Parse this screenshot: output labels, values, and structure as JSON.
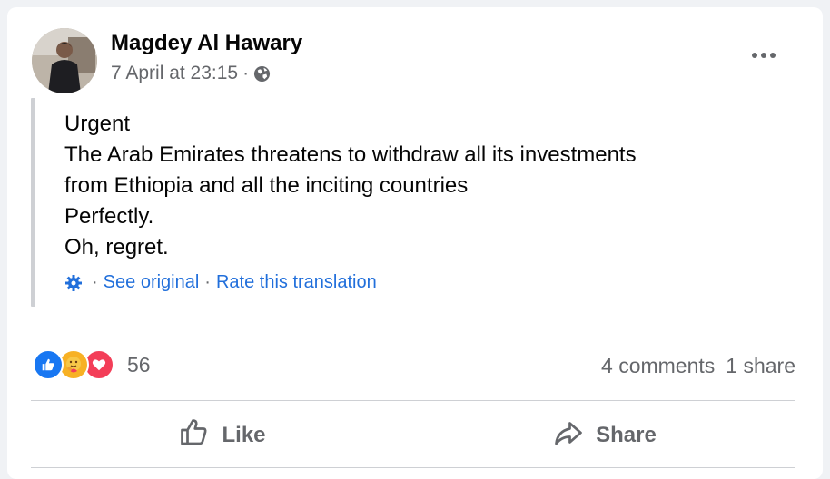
{
  "post": {
    "author": "Magdey Al Hawary",
    "timestamp": "7 April at 23:15",
    "separator": "·",
    "privacy_icon": "globe-icon",
    "lines": [
      "Urgent",
      "The Arab Emirates threatens to withdraw all its investments",
      "from Ethiopia and all the inciting countries",
      "Perfectly.",
      "Oh, regret."
    ],
    "translation": {
      "icon": "gear-icon",
      "see_original": "See original",
      "rate": "Rate this translation",
      "separator": "·"
    }
  },
  "stats": {
    "reaction_icons": [
      "like-icon",
      "care-icon",
      "love-icon"
    ],
    "reaction_count": "56",
    "comments": "4 comments",
    "shares": "1 share"
  },
  "actions": {
    "like": "Like",
    "share": "Share"
  },
  "colors": {
    "link": "#216fdb",
    "secondary_text": "#65676b",
    "like_blue": "#1877f2",
    "love_red": "#f33e58",
    "care_yellow": "#f7b125"
  }
}
